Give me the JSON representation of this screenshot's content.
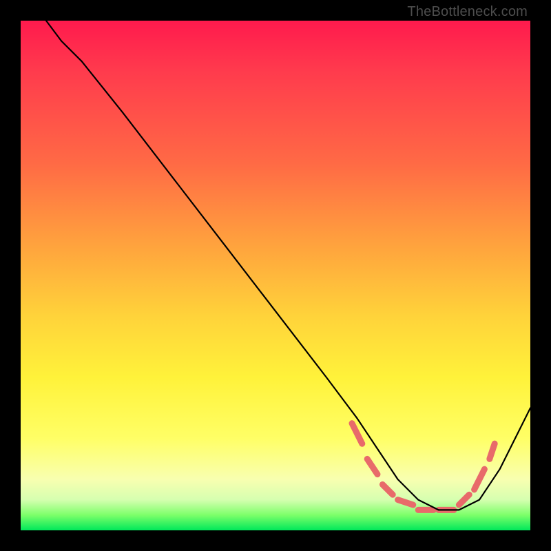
{
  "watermark": "TheBottleneck.com",
  "chart_data": {
    "type": "line",
    "title": "",
    "xlabel": "",
    "ylabel": "",
    "xlim": [
      0,
      100
    ],
    "ylim": [
      0,
      100
    ],
    "grid": false,
    "legend": false,
    "background_gradient": {
      "orientation": "vertical",
      "stops": [
        {
          "pos": 0.0,
          "color": "#ff1a4d"
        },
        {
          "pos": 0.28,
          "color": "#ff6a45"
        },
        {
          "pos": 0.58,
          "color": "#ffd33a"
        },
        {
          "pos": 0.82,
          "color": "#ffff66"
        },
        {
          "pos": 0.94,
          "color": "#d6ffb0"
        },
        {
          "pos": 1.0,
          "color": "#00e85a"
        }
      ]
    },
    "series": [
      {
        "name": "curve",
        "color": "#000000",
        "x": [
          5,
          8,
          12,
          20,
          30,
          40,
          50,
          60,
          66,
          70,
          74,
          78,
          82,
          86,
          90,
          94,
          100
        ],
        "y": [
          100,
          96,
          92,
          82,
          69,
          56,
          43,
          30,
          22,
          16,
          10,
          6,
          4,
          4,
          6,
          12,
          24
        ]
      }
    ],
    "highlight_segments": {
      "name": "bottom-dash-markers",
      "color": "#e86a6a",
      "stroke_width": 9,
      "segments": [
        {
          "x0": 65,
          "y0": 21,
          "x1": 67,
          "y1": 17
        },
        {
          "x0": 68,
          "y0": 14,
          "x1": 70,
          "y1": 11
        },
        {
          "x0": 71,
          "y0": 9,
          "x1": 73,
          "y1": 7
        },
        {
          "x0": 74,
          "y0": 6,
          "x1": 77,
          "y1": 5
        },
        {
          "x0": 78,
          "y0": 4,
          "x1": 81,
          "y1": 4
        },
        {
          "x0": 82,
          "y0": 4,
          "x1": 85,
          "y1": 4
        },
        {
          "x0": 86,
          "y0": 5,
          "x1": 88,
          "y1": 7
        },
        {
          "x0": 89,
          "y0": 8,
          "x1": 91,
          "y1": 12
        },
        {
          "x0": 92,
          "y0": 14,
          "x1": 93,
          "y1": 17
        }
      ]
    }
  }
}
